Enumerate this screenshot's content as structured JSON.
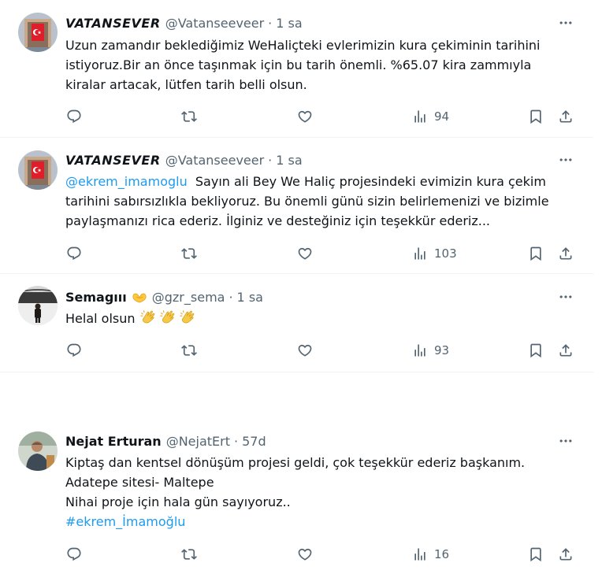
{
  "tweets": [
    {
      "name": "VATANSEVER",
      "handle": "@Vatanseeveer",
      "sep": "·",
      "time": "1 sa",
      "lines": [
        "Uzun zamandır beklediğimiz WeHaliçteki evlerimizin kura çekiminin tarihini",
        "istiyoruz.Bir an önce taşınmak için bu tarih önemli. %65.07 kira zammıyla",
        "kiralar artacak, lütfen tarih belli olsun."
      ],
      "views": "94"
    },
    {
      "name": "VATANSEVER",
      "handle": "@Vatanseeveer",
      "sep": "·",
      "time": "1 sa",
      "mention": "@ekrem_imamoglu",
      "line1_rest": "  Sayın ali Bey We Haliç projesindeki evimizin kura çekim",
      "lines": [
        "tarihini sabırsızlıkla bekliyoruz. Bu önemli günü sizin belirlemenizi ve bizimle",
        "paylaşmanızı rica ederiz. İlginiz ve desteğiniz için teşekkür ederiz..."
      ],
      "views": "103"
    },
    {
      "name": "Semagııı",
      "badge_icon": "heart-hands-emoji",
      "handle": "@gzr_sema",
      "sep": "·",
      "time": "1 sa",
      "text": "Helal olsun",
      "emoji": "clapping-hands-emoji",
      "views": "93"
    },
    {
      "name": "Nejat Erturan",
      "handle": "@NejatErt",
      "sep": "·",
      "time": "57d",
      "lines": [
        "Kiptaş dan  kentsel dönüşüm projesi geldi, çok teşekkür ederiz başkanım.",
        "Adatepe sitesi- Maltepe",
        "Nihai proje için hala gün sayıyoruz.."
      ],
      "hashtag": "#ekrem_İmamoğlu",
      "views": "16"
    }
  ],
  "colors": {
    "text": "#0f1419",
    "secondary": "#536471",
    "link": "#1d9bf0",
    "divider": "#eff3f4"
  }
}
